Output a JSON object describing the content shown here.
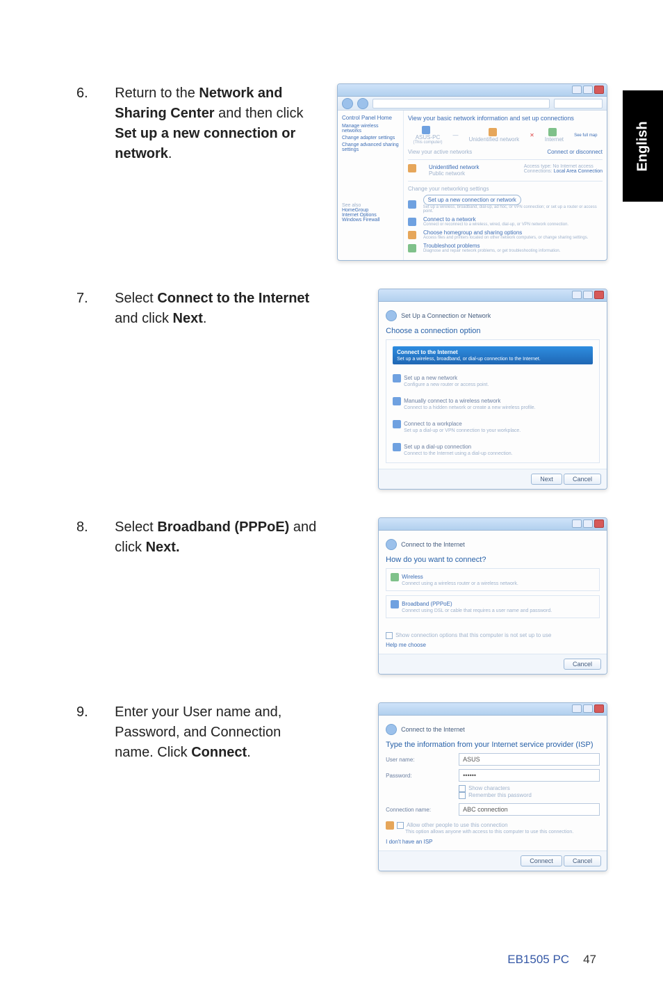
{
  "language_tab": "English",
  "steps": [
    {
      "num": "6.",
      "text_parts": [
        "Return to the ",
        "Network and Sharing Center",
        " and then click ",
        "Set up a new connection or network",
        "."
      ]
    },
    {
      "num": "7.",
      "text_parts": [
        "Select ",
        "Connect to the Internet",
        " and click ",
        "Next",
        "."
      ]
    },
    {
      "num": "8.",
      "text_parts": [
        "Select ",
        "Broadband (PPPoE)",
        " and click ",
        "Next.",
        ""
      ]
    },
    {
      "num": "9.",
      "text_parts": [
        "Enter your User name and, Password, and Connection name. Click ",
        "Connect",
        ".",
        "",
        ""
      ]
    }
  ],
  "shot6": {
    "sidebar_title": "Control Panel Home",
    "sidebar_items": [
      "Manage wireless networks",
      "Change adapter settings",
      "Change advanced sharing settings"
    ],
    "see_also": "See also",
    "see_also_items": [
      "HomeGroup",
      "Internet Options",
      "Windows Firewall"
    ],
    "heading": "View your basic network information and set up connections",
    "map_full": "See full map",
    "node1": "ASUS-PC",
    "node1_sub": "(This computer)",
    "node2": "Unidentified network",
    "node3": "Internet",
    "active_label": "View your active networks",
    "connect_label": "Connect or disconnect",
    "net_name": "Unidentified network",
    "net_type": "Public network",
    "access_lbl": "Access type:",
    "access_val": "No Internet access",
    "conn_lbl": "Connections:",
    "conn_val": "Local Area Connection",
    "change_label": "Change your networking settings",
    "opt1_title": "Set up a new connection or network",
    "opt1_sub": "Set up a wireless, broadband, dial-up, ad hoc, or VPN connection; or set up a router or access point.",
    "opt2_title": "Connect to a network",
    "opt2_sub": "Connect or reconnect to a wireless, wired, dial-up, or VPN network connection.",
    "opt3_title": "Choose homegroup and sharing options",
    "opt3_sub": "Access files and printers located on other network computers, or change sharing settings.",
    "opt4_title": "Troubleshoot problems",
    "opt4_sub": "Diagnose and repair network problems, or get troubleshooting information."
  },
  "shot7": {
    "title": "Set Up a Connection or Network",
    "heading": "Choose a connection option",
    "opt1_title": "Connect to the Internet",
    "opt1_sub": "Set up a wireless, broadband, or dial-up connection to the Internet.",
    "opt2_title": "Set up a new network",
    "opt2_sub": "Configure a new router or access point.",
    "opt3_title": "Manually connect to a wireless network",
    "opt3_sub": "Connect to a hidden network or create a new wireless profile.",
    "opt4_title": "Connect to a workplace",
    "opt4_sub": "Set up a dial-up or VPN connection to your workplace.",
    "opt5_title": "Set up a dial-up connection",
    "opt5_sub": "Connect to the Internet using a dial-up connection.",
    "btn_next": "Next",
    "btn_cancel": "Cancel"
  },
  "shot8": {
    "title": "Connect to the Internet",
    "heading": "How do you want to connect?",
    "opt1_title": "Wireless",
    "opt1_sub": "Connect using a wireless router or a wireless network.",
    "opt2_title": "Broadband (PPPoE)",
    "opt2_sub": "Connect using DSL or cable that requires a user name and password.",
    "show_more": "Show connection options that this computer is not set up to use",
    "help": "Help me choose",
    "btn_cancel": "Cancel"
  },
  "shot9": {
    "title": "Connect to the Internet",
    "heading": "Type the information from your Internet service provider (ISP)",
    "user_lbl": "User name:",
    "user_val": "ASUS",
    "pass_lbl": "Password:",
    "pass_val": "••••••",
    "show_chars": "Show characters",
    "remember": "Remember this password",
    "conn_lbl": "Connection name:",
    "conn_val": "ABC connection",
    "allow_title": "Allow other people to use this connection",
    "allow_sub": "This option allows anyone with access to this computer to use this connection.",
    "no_isp": "I don't have an ISP",
    "btn_connect": "Connect",
    "btn_cancel": "Cancel"
  },
  "footer": {
    "model": "EB1505 PC",
    "page": "47"
  }
}
